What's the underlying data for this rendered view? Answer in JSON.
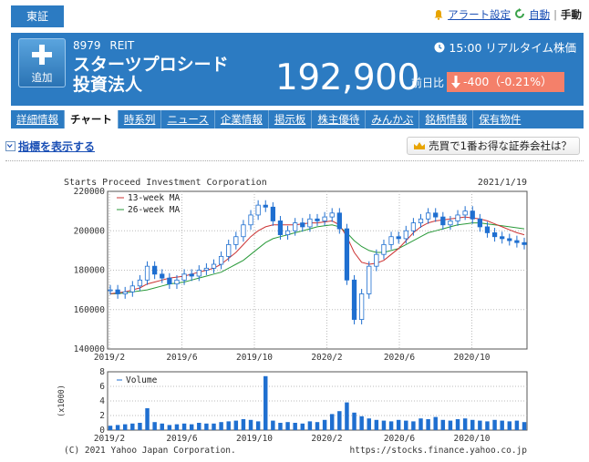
{
  "exchange": "東証",
  "top_links": {
    "alert": "アラート設定",
    "auto": "自動",
    "manual": "手動"
  },
  "stock": {
    "code": "8979",
    "type": "REIT",
    "name": "スターツプロシード投資法人",
    "time_label": "15:00 リアルタイム株価",
    "price": "192,900",
    "change_label": "前日比",
    "change": "-400（-0.21%）"
  },
  "add_button": "追加",
  "tabs": [
    {
      "label": "詳細情報"
    },
    {
      "label": "チャート"
    },
    {
      "label": "時系列"
    },
    {
      "label": "ニュース"
    },
    {
      "label": "企業情報"
    },
    {
      "label": "掲示板"
    },
    {
      "label": "株主優待"
    },
    {
      "label": "みんかぶ"
    },
    {
      "label": "銘柄情報"
    },
    {
      "label": "保有物件"
    }
  ],
  "indicators_link": "指標を表示する",
  "broker_button": "売買で1番お得な証券会社は？",
  "colors": {
    "brand": "#2c7bc2",
    "down": "#f4806a",
    "candle": "#1f6fd0",
    "ma13": "#cc3333",
    "ma26": "#2a9a3a"
  },
  "chart_data": {
    "type": "candlestick",
    "title": "Starts Proceed Investment Corporation",
    "date": "2021/1/19",
    "ylim": [
      140000,
      220000
    ],
    "yticks": [
      "220000",
      "200000",
      "180000",
      "160000",
      "140000"
    ],
    "xticks": [
      "2019/2",
      "2019/6",
      "2019/10",
      "2020/2",
      "2020/6",
      "2020/10"
    ],
    "legend": [
      "13-week MA",
      "26-week MA"
    ],
    "close_series_weekly": [
      170000,
      168000,
      169000,
      172000,
      175000,
      182000,
      178000,
      176000,
      173000,
      175000,
      178000,
      177000,
      180000,
      181000,
      183000,
      187000,
      193000,
      197000,
      203000,
      208000,
      213000,
      212000,
      205000,
      198000,
      200000,
      204000,
      202000,
      206000,
      205000,
      207000,
      209000,
      201000,
      175000,
      155000,
      168000,
      182000,
      188000,
      193000,
      197000,
      196000,
      200000,
      204000,
      206000,
      209000,
      207000,
      203000,
      205000,
      208000,
      210000,
      206000,
      202000,
      199000,
      197000,
      196000,
      195000,
      194000,
      193000
    ],
    "ma13_weekly": [
      168000,
      168500,
      169000,
      170000,
      171000,
      173000,
      174000,
      175000,
      176000,
      176500,
      177000,
      178000,
      179000,
      180000,
      181000,
      183000,
      186000,
      189000,
      193000,
      197000,
      200000,
      202000,
      203000,
      203000,
      203000,
      203000,
      203500,
      204000,
      204000,
      204500,
      205000,
      203000,
      197000,
      189000,
      184000,
      183000,
      183500,
      185000,
      188000,
      191000,
      195000,
      199000,
      202000,
      204000,
      205000,
      205500,
      206000,
      206500,
      207000,
      206500,
      206000,
      205000,
      203500,
      202000,
      200500,
      199000,
      198000
    ],
    "ma26_weekly": [
      168000,
      168000,
      168500,
      169000,
      169500,
      170000,
      171000,
      172000,
      173000,
      173500,
      174000,
      175000,
      176000,
      177000,
      178000,
      179000,
      181000,
      183000,
      185000,
      188000,
      191000,
      194000,
      196000,
      197000,
      198000,
      199000,
      200000,
      201000,
      202000,
      202500,
      203000,
      202000,
      199000,
      195000,
      192000,
      190000,
      189000,
      189000,
      190000,
      191000,
      193000,
      195000,
      197000,
      199000,
      200000,
      201000,
      202000,
      203000,
      203500,
      204000,
      204000,
      203500,
      203000,
      202500,
      202000,
      201500,
      201000
    ],
    "volume": {
      "label": "Volume",
      "yticks": [
        "8",
        "6",
        "4",
        "2",
        "0"
      ],
      "ylabel": "(x1000)",
      "ylim": [
        0,
        8
      ],
      "values_weekly": [
        0.6,
        0.7,
        0.8,
        0.9,
        1.0,
        3.0,
        1.1,
        0.9,
        0.7,
        0.8,
        0.9,
        0.8,
        1.0,
        0.9,
        0.9,
        1.1,
        1.2,
        1.3,
        1.5,
        1.4,
        1.2,
        7.4,
        1.3,
        1.0,
        1.1,
        1.0,
        0.9,
        1.2,
        1.1,
        1.4,
        2.2,
        2.6,
        3.8,
        2.4,
        1.9,
        1.6,
        1.4,
        1.3,
        1.2,
        1.4,
        1.3,
        1.2,
        1.6,
        1.5,
        1.8,
        1.4,
        1.3,
        1.5,
        1.6,
        1.4,
        1.3,
        1.2,
        1.4,
        1.3,
        1.2,
        1.3,
        1.1
      ]
    },
    "footer_left": "(C) 2021 Yahoo Japan Corporation.",
    "footer_right": "https://stocks.finance.yahoo.co.jp"
  }
}
